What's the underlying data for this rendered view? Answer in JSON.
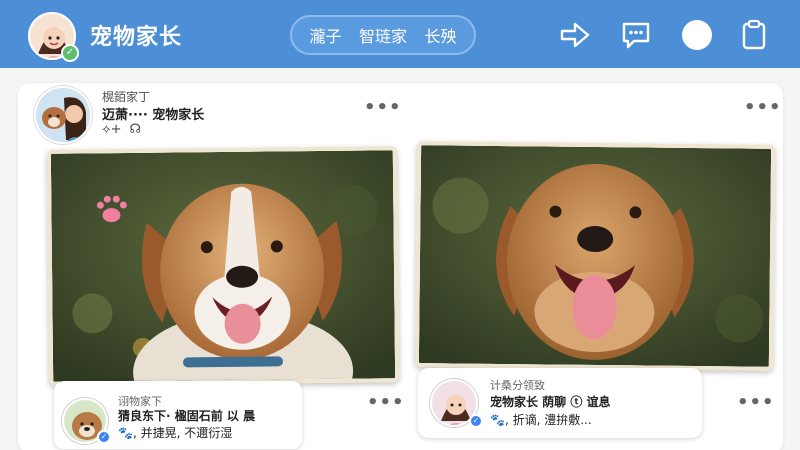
{
  "header": {
    "title": "宠物家长",
    "tabs": [
      "瀧子",
      "智琏家",
      "长殃"
    ],
    "bg_color": "#4d8fd6"
  },
  "icons": [
    "share-icon",
    "message-icon",
    "status-dot",
    "clipboard-icon"
  ],
  "post": {
    "subtitle": "榥銆家丁",
    "author_line": "迈萧···· 宠物家长",
    "actions": [
      "⟡+",
      "☊"
    ],
    "more": "•••"
  },
  "comments": [
    {
      "line1": "诩物家下",
      "line2": "猜良东下·  楹固石前 以 晨",
      "line3": "🐾, 并捷晃,  不邇衍湿"
    },
    {
      "line1": "计桑分领致",
      "line2": "宠物家长  荫聊 ⓣ 谊息",
      "line3": "🐾, 折谪,  澧拚敷..."
    }
  ],
  "colors": {
    "accent": "#4d8fd6",
    "verified": "#5bbf6b",
    "blue_badge": "#3b82f6"
  }
}
